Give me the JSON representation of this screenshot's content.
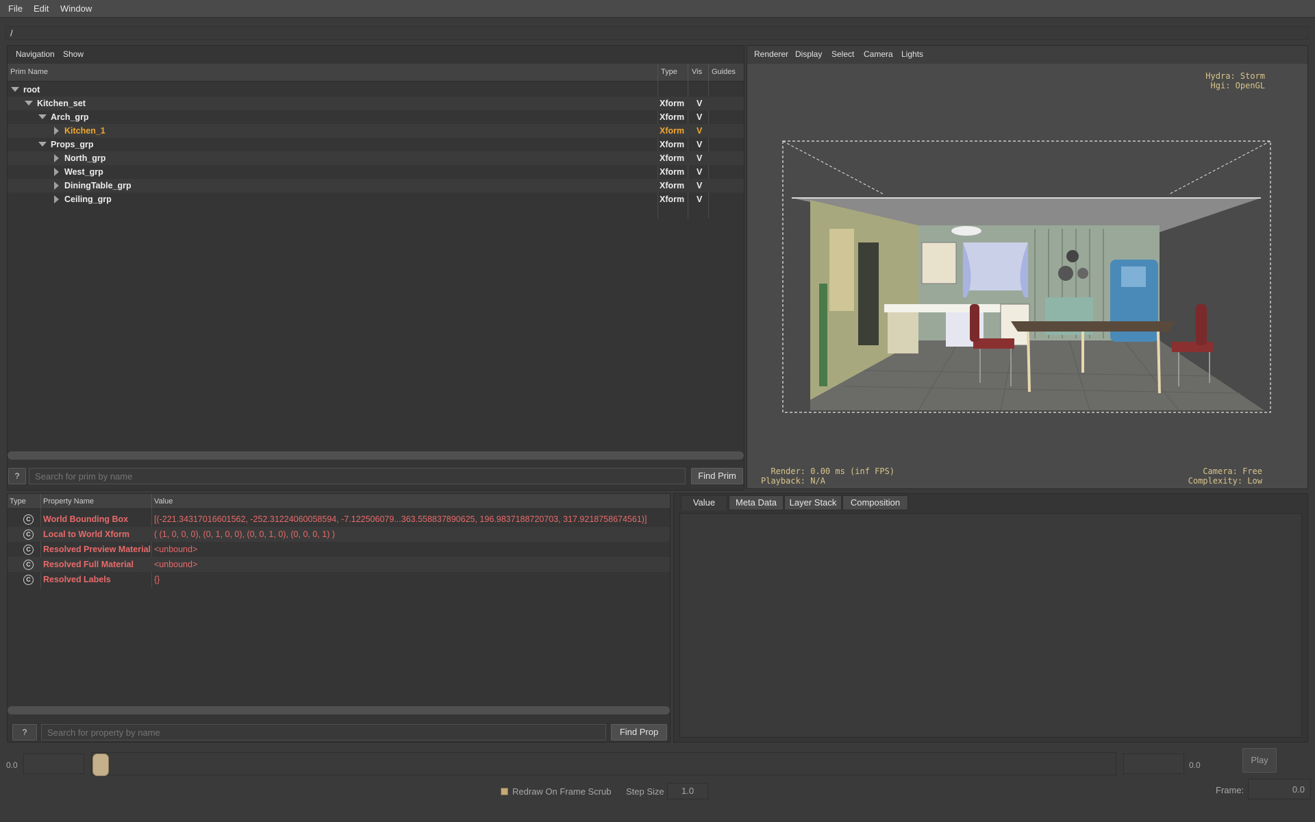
{
  "menubar": {
    "items": [
      "File",
      "Edit",
      "Window"
    ]
  },
  "path_bar": {
    "value": "/"
  },
  "prim_panel": {
    "nav": [
      "Navigation",
      "Show"
    ],
    "columns": [
      "Prim Name",
      "Type",
      "Vis",
      "Guides"
    ],
    "rows": [
      {
        "name": "root",
        "type": "",
        "vis": "",
        "level": 0,
        "expanded": true
      },
      {
        "name": "Kitchen_set",
        "type": "Xform",
        "vis": "V",
        "level": 1,
        "expanded": true
      },
      {
        "name": "Arch_grp",
        "type": "Xform",
        "vis": "V",
        "level": 2,
        "expanded": true
      },
      {
        "name": "Kitchen_1",
        "type": "Xform",
        "vis": "V",
        "level": 3,
        "expanded": false,
        "selected": true
      },
      {
        "name": "Props_grp",
        "type": "Xform",
        "vis": "V",
        "level": 2,
        "expanded": true
      },
      {
        "name": "North_grp",
        "type": "Xform",
        "vis": "V",
        "level": 3,
        "expanded": false
      },
      {
        "name": "West_grp",
        "type": "Xform",
        "vis": "V",
        "level": 3,
        "expanded": false
      },
      {
        "name": "DiningTable_grp",
        "type": "Xform",
        "vis": "V",
        "level": 3,
        "expanded": false
      },
      {
        "name": "Ceiling_grp",
        "type": "Xform",
        "vis": "V",
        "level": 3,
        "expanded": false
      }
    ],
    "search": {
      "help_label": "?",
      "placeholder": "Search for prim by name",
      "button": "Find Prim"
    }
  },
  "viewport": {
    "menus": [
      "Renderer",
      "Display",
      "Select",
      "Camera",
      "Lights"
    ],
    "hud_top_right": "Hydra: Storm\n  Hgi: OpenGL",
    "hud_bottom_left": "  Render: 0.00 ms (inf FPS)\nPlayback: N/A",
    "hud_bottom_right": "    Camera: Free\nComplexity: Low"
  },
  "property_panel": {
    "columns": [
      "Type",
      "Property Name",
      "Value"
    ],
    "icon_glyph": "C",
    "rows": [
      {
        "name": "World Bounding Box",
        "value": "[(-221.34317016601562, -252.31224060058594, -7.122506079...363.558837890625, 196.9837188720703, 317.9218758674561)]"
      },
      {
        "name": "Local to World Xform",
        "value": "( (1, 0, 0, 0), (0, 1, 0, 0), (0, 0, 1, 0), (0, 0, 0, 1) )"
      },
      {
        "name": "Resolved Preview Material",
        "value": "<unbound>"
      },
      {
        "name": "Resolved Full Material",
        "value": "<unbound>"
      },
      {
        "name": "Resolved Labels",
        "value": "{}"
      }
    ],
    "search": {
      "help_label": "?",
      "placeholder": "Search for property by name",
      "button": "Find Prop"
    }
  },
  "value_panel": {
    "tabs": [
      "Value",
      "Meta Data",
      "Layer Stack",
      "Composition"
    ],
    "active": 0
  },
  "timeline": {
    "start_label": "0.0",
    "end_label": "0.0",
    "redraw_label": "Redraw On Frame Scrub",
    "step_size_label": "Step Size",
    "step_size_value": "1.0",
    "play_label": "Play",
    "frame_label": "Frame:",
    "frame_value": "0.0"
  },
  "colors": {
    "selected": "#f0a830",
    "property_text": "#e86a6a",
    "hud_text": "#d8c48a"
  }
}
